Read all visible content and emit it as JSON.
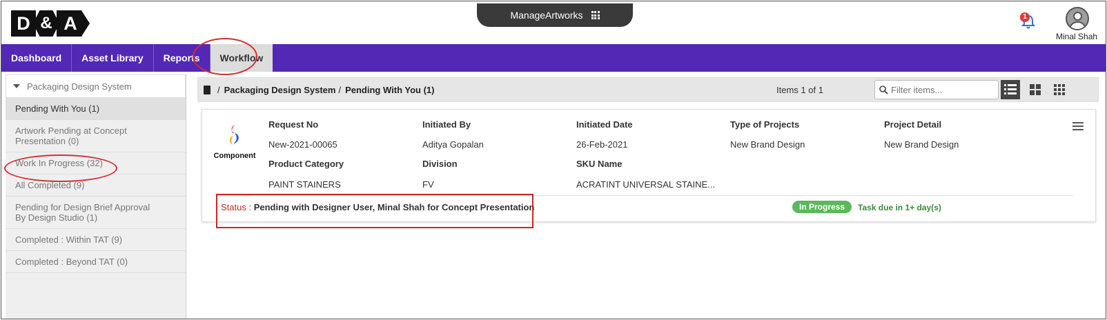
{
  "header": {
    "logo": {
      "left": "D",
      "amp": "&",
      "right": "A"
    },
    "app_name": "ManageArtworks",
    "notification_count": "1",
    "user_name": "Minal Shah"
  },
  "nav": {
    "items": [
      {
        "label": "Dashboard"
      },
      {
        "label": "Asset Library"
      },
      {
        "label": "Reports"
      },
      {
        "label": "Workflow"
      }
    ],
    "active": "Workflow"
  },
  "sidebar": {
    "group_title": "Packaging Design System",
    "items": [
      {
        "label": "Pending With You (1)"
      },
      {
        "label": "Artwork Pending at Concept Presentation (0)"
      },
      {
        "label": "Work In Progress (32)"
      },
      {
        "label": "All Completed (9)"
      },
      {
        "label": "Pending for Design Brief Approval By Design Studio (1)"
      },
      {
        "label": "Completed : Within TAT (9)"
      },
      {
        "label": "Completed : Beyond TAT (0)"
      }
    ]
  },
  "toolbar": {
    "breadcrumb": [
      "Packaging Design System",
      "Pending With You (1)"
    ],
    "separator": "/",
    "items_count": "Items 1 of 1",
    "filter_placeholder": "Filter items..."
  },
  "card": {
    "logo_text": "Component",
    "fields": {
      "request_no_label": "Request No",
      "request_no": "New-2021-00065",
      "initiated_by_label": "Initiated By",
      "initiated_by": "Aditya Gopalan",
      "initiated_date_label": "Initiated Date",
      "initiated_date": "26-Feb-2021",
      "project_type_label": "Type of Projects",
      "project_type": "New Brand Design",
      "project_detail_label": "Project Detail",
      "project_detail": "New Brand Design",
      "product_category_label": "Product Category",
      "product_category": "PAINT STAINERS",
      "division_label": "Division",
      "division": "FV",
      "sku_label": "SKU Name",
      "sku": "ACRATINT UNIVERSAL STAINE..."
    },
    "status_key": "Status : ",
    "status_value": "Pending with Designer User, Minal Shah for Concept Presentation",
    "progress_label": "In Progress",
    "due_text": "Task due in 1+ day(s)"
  },
  "colors": {
    "nav_bg": "#5228b4",
    "highlight_red": "#d32f2f",
    "progress_green": "#5cb85c",
    "due_green": "#3c8a3c"
  }
}
